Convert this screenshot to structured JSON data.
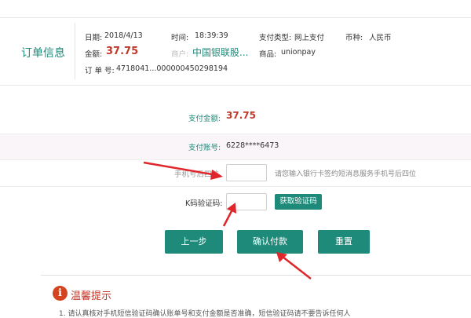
{
  "order": {
    "title": "订单信息",
    "date_label": "日期:",
    "date_value": "2018/4/13",
    "time_label": "时间:",
    "time_value": "18:39:39",
    "pay_type_label": "支付类型:",
    "pay_type_value": "网上支付",
    "currency_label": "币种:",
    "currency_value": "人民币",
    "amount_label": "金额:",
    "amount_value": "37.75",
    "merchant_label": "商户:",
    "merchant_value": "中国银联股...",
    "product_label": "商品:",
    "product_value": "unionpay",
    "order_no_label": "订 单 号:",
    "order_no_value": "4718041...000000450298194"
  },
  "payment": {
    "amount_label": "支付金额:",
    "amount_value": "37.75",
    "account_label": "支付账号:",
    "account_value": "6228****6473",
    "phone_label": "手机号后四位",
    "phone_hint": "请您输入银行卡签约短消息服务手机号后四位",
    "code_label": "K码验证码:",
    "get_code_label": "获取验证码"
  },
  "actions": {
    "back_label": "上一步",
    "confirm_label": "确认付款",
    "reset_label": "重置"
  },
  "tips": {
    "icon_glyph": "i",
    "title": "温馨提示",
    "text": "1. 请认真核对手机短信验证码确认账单号和支付金额是否准确，短信验证码请不要告诉任何人"
  },
  "colors": {
    "accent": "#1e8a79",
    "amount_red": "#c0392b",
    "arrow_red": "#e0262b"
  }
}
